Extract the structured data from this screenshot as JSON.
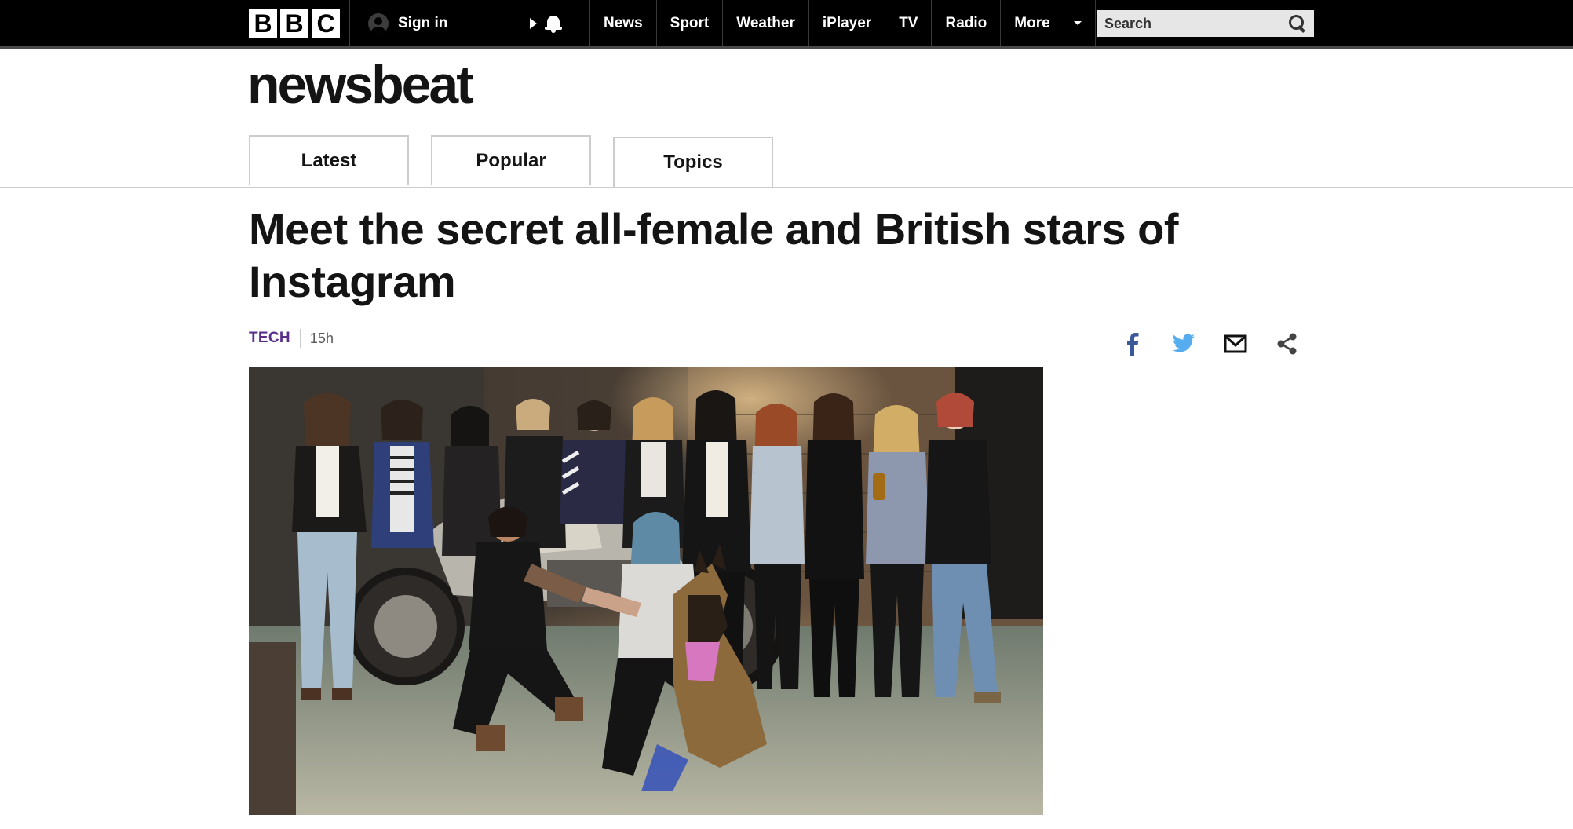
{
  "topbar": {
    "logo_letters": [
      "B",
      "B",
      "C"
    ],
    "signin_label": "Sign in",
    "nav_items": [
      "News",
      "Sport",
      "Weather",
      "iPlayer",
      "TV",
      "Radio"
    ],
    "more_label": "More",
    "search_placeholder": "Search",
    "icons": [
      "user-avatar-icon",
      "play-icon",
      "bell-icon",
      "chevron-down-icon",
      "search-icon"
    ]
  },
  "brand": {
    "name": "newsbeat"
  },
  "tabs": [
    {
      "label": "Latest"
    },
    {
      "label": "Popular"
    },
    {
      "label": "Topics"
    }
  ],
  "article": {
    "headline": "Meet the secret all-female and British stars of Instagram",
    "topic": "TECH",
    "time": "15h",
    "share_icons": [
      "facebook-icon",
      "twitter-icon",
      "email-icon",
      "share-icon"
    ]
  },
  "colors": {
    "topbar_bg": "#000000",
    "topic_purple": "#5a2f8c",
    "facebook_blue": "#3b5998",
    "twitter_blue": "#55acee",
    "tab_border": "#cccccc"
  }
}
